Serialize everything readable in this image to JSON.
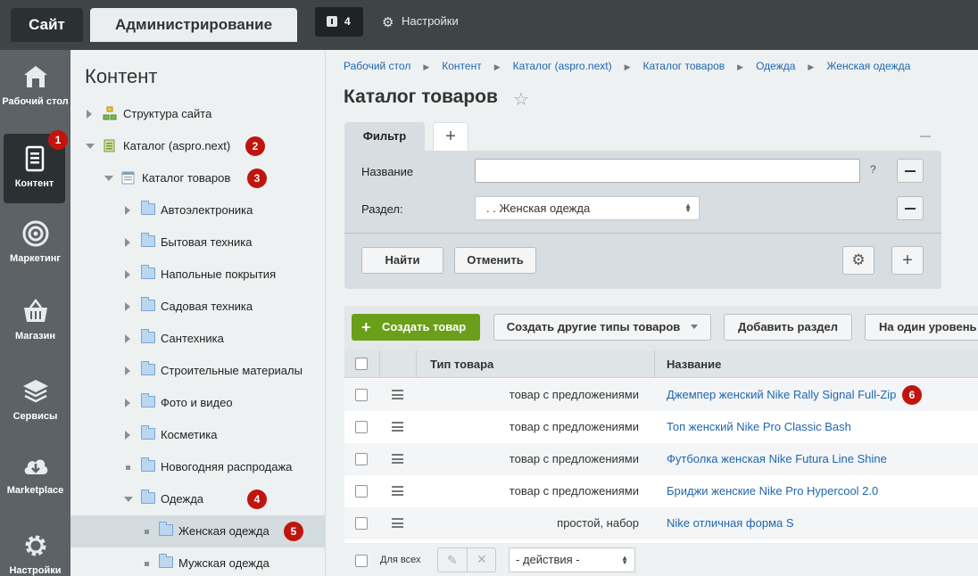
{
  "topbar": {
    "site_label": "Сайт",
    "admin_label": "Администрирование",
    "notifications_count": "4",
    "settings_label": "Настройки"
  },
  "left_menu": {
    "items": [
      {
        "label": "Рабочий стол",
        "icon": "home-icon"
      },
      {
        "label": "Контент",
        "icon": "document-icon",
        "active": true,
        "badge": "1"
      },
      {
        "label": "Маркетинг",
        "icon": "target-icon"
      },
      {
        "label": "Магазин",
        "icon": "basket-icon"
      },
      {
        "label": "Сервисы",
        "icon": "layers-icon"
      },
      {
        "label": "Marketplace",
        "icon": "cloud-download-icon"
      },
      {
        "label": "Настройки",
        "icon": "gear-icon"
      }
    ]
  },
  "tree": {
    "title": "Контент",
    "items": [
      {
        "label": "Структура сайта",
        "icon": "structure-icon"
      },
      {
        "label": "Каталог (aspro.next)",
        "icon": "catalog-icon",
        "badge": "2"
      },
      {
        "label": "Каталог товаров",
        "icon": "list-icon",
        "badge": "3"
      },
      {
        "label": "Автоэлектроника"
      },
      {
        "label": "Бытовая техника"
      },
      {
        "label": "Напольные покрытия"
      },
      {
        "label": "Садовая техника"
      },
      {
        "label": "Сантехника"
      },
      {
        "label": "Строительные материалы"
      },
      {
        "label": "Фото и видео"
      },
      {
        "label": "Косметика"
      },
      {
        "label": "Новогодняя распродажа"
      },
      {
        "label": "Одежда",
        "badge": "4"
      },
      {
        "label": "Женская одежда",
        "badge": "5"
      },
      {
        "label": "Мужская одежда"
      }
    ]
  },
  "breadcrumb": [
    "Рабочий стол",
    "Контент",
    "Каталог (aspro.next)",
    "Каталог товаров",
    "Одежда",
    "Женская одежда"
  ],
  "page_title": "Каталог товаров",
  "filter": {
    "tab_label": "Фильтр",
    "name_label": "Название",
    "name_value": "",
    "help": "?",
    "section_label": "Раздел:",
    "section_value": ". . Женская одежда",
    "find_label": "Найти",
    "cancel_label": "Отменить"
  },
  "toolbar": {
    "create_label": "Создать товар",
    "other_types_label": "Создать другие типы товаров",
    "add_section_label": "Добавить раздел",
    "level_up_label": "На один уровень"
  },
  "table": {
    "headers": {
      "type": "Тип товара",
      "name": "Название"
    },
    "rows": [
      {
        "type": "товар с предложениями",
        "name": "Джемпер женский Nike Rally Signal Full-Zip",
        "badge": "6"
      },
      {
        "type": "товар с предложениями",
        "name": "Топ женский Nike Pro Classic Bash"
      },
      {
        "type": "товар с предложениями",
        "name": "Футболка женская Nike Futura Line Shine"
      },
      {
        "type": "товар с предложениями",
        "name": "Бриджи женские Nike Pro Hypercool 2.0"
      },
      {
        "type": "простой, набор",
        "name": "Nike отличная форма S"
      }
    ],
    "footer": {
      "for_all_label": "Для всех",
      "actions_value": "- действия -"
    }
  },
  "colors": {
    "accent": "#2067b0",
    "create_button": "#6a9f19",
    "badge": "#c0140e",
    "topbar": "#3f4447",
    "leftmenu": "#5c6266"
  }
}
